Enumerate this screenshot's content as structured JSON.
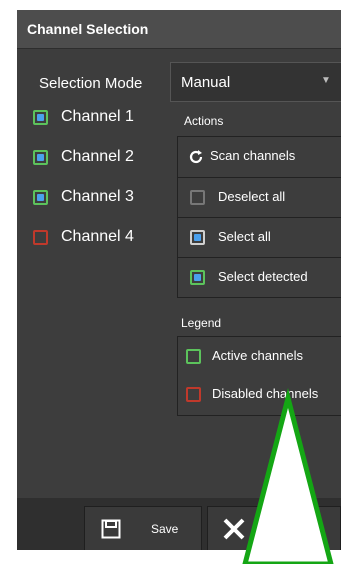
{
  "window": {
    "title": "Channel Selection"
  },
  "mode": {
    "label": "Selection Mode",
    "value": "Manual"
  },
  "channels": [
    {
      "label": "Channel 1",
      "state": "active-selected",
      "border": "#5cc35c"
    },
    {
      "label": "Channel 2",
      "state": "active-selected",
      "border": "#5cc35c"
    },
    {
      "label": "Channel 3",
      "state": "active-selected",
      "border": "#5cc35c"
    },
    {
      "label": "Channel 4",
      "state": "disabled",
      "border": "#c0392b"
    }
  ],
  "actions": {
    "heading": "Actions",
    "scan_label": "Scan channels",
    "deselect_label": "Deselect all",
    "select_all_label": "Select all",
    "select_detected_label": "Select detected"
  },
  "legend": {
    "heading": "Legend",
    "active_label": "Active channels",
    "disabled_label": "Disabled channels"
  },
  "footer": {
    "save_label": "Save"
  },
  "colors": {
    "active": "#5cc35c",
    "disabled": "#c0392b",
    "selected_fill": "#4aa0ee",
    "annotation": "#14a614"
  }
}
